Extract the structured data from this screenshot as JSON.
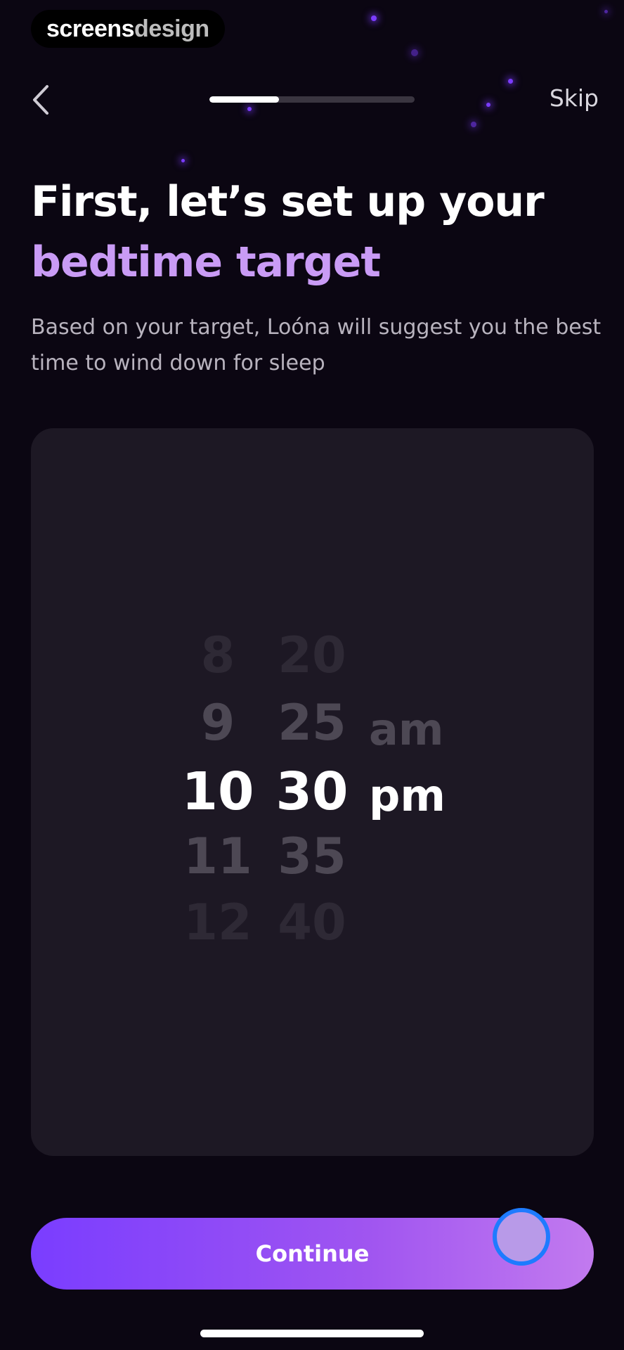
{
  "brand": {
    "part1": "screens",
    "part2": "design"
  },
  "nav": {
    "back_icon": "chevron-left-icon",
    "skip_label": "Skip",
    "progress": 0.34
  },
  "heading": {
    "line1": "First, let’s set up your",
    "line2": "bedtime target"
  },
  "subtitle": "Based on your target, Loóna will suggest you the best time to wind down for sleep",
  "picker": {
    "hours": [
      "8",
      "9",
      "10",
      "11",
      "12"
    ],
    "minutes": [
      "20",
      "25",
      "30",
      "35",
      "40"
    ],
    "periods": [
      "am",
      "pm"
    ],
    "selected": {
      "hour": "10",
      "minute": "30",
      "period": "pm"
    }
  },
  "continue_label": "Continue",
  "colors": {
    "accent": "#c99bf5",
    "button_start": "#7a3dff",
    "button_end": "#c27aef",
    "background": "#0b0612",
    "card": "#1d1824"
  }
}
